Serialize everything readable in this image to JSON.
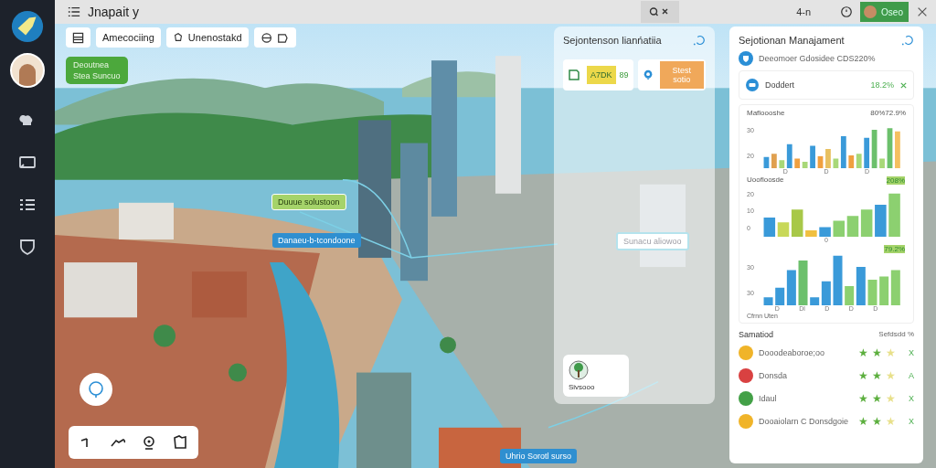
{
  "app": {
    "title": "Jnapait y"
  },
  "topbar": {
    "counter": "4-n",
    "user": "Oseo"
  },
  "toolbar": {
    "buttons": [
      {
        "kind": "icon"
      },
      {
        "kind": "text",
        "label": "Amecociing"
      },
      {
        "kind": "icon-text",
        "label": "Unenostakd"
      },
      {
        "kind": "icons"
      }
    ]
  },
  "map": {
    "badge": [
      "Deoutnea",
      "Stea Suncuo"
    ],
    "callouts": [
      {
        "text": "Duuue solustoon",
        "kind": "green"
      },
      {
        "text": "Danaeu-b-tcondoone",
        "kind": "blue"
      },
      {
        "text": "Sunacu aliowoo",
        "kind": "white"
      },
      {
        "text": "Uhrio Sorotl surso",
        "kind": "blue"
      }
    ]
  },
  "float_panel": {
    "title": "Sejontenson lianńatiia",
    "chip": "A7DK",
    "value": "89",
    "action": "Stest sotio",
    "card_label": "Sivsooo"
  },
  "side_panel": {
    "title": "Sejotionan Manajament",
    "info": "Deeomoer Gdosidee CDS220%",
    "card": {
      "label": "Doddert",
      "value": "18.2%"
    },
    "charts": [
      {
        "title": "Mafloooshe",
        "value": "80%72.9%",
        "ticks": [
          "30",
          "20"
        ],
        "axis": [
          "D",
          "D",
          "D"
        ]
      },
      {
        "title": "Uoofloosde",
        "value": "208%",
        "ticks": [
          "20",
          "10",
          "0"
        ],
        "axis": [
          "0"
        ]
      },
      {
        "value": "79.2%",
        "ticks": [
          "30",
          "30"
        ],
        "axis": [
          "D",
          "Dl",
          "D",
          "D",
          "D"
        ]
      }
    ],
    "footer": "Cfrnn Uten",
    "list_title": "Samatiod",
    "list_value": "Sefdsdd %",
    "items": [
      {
        "label": "Dooodeaboroe;oo",
        "color": "#f0b429",
        "stars": 2,
        "action": "X"
      },
      {
        "label": "Donsda",
        "color": "#d94141",
        "stars": 2,
        "action": "A"
      },
      {
        "label": "Idaul",
        "color": "#43a047",
        "stars": 2,
        "action": "X"
      },
      {
        "label": "Dooaiolarn C Donsdgoie",
        "color": "#f0b429",
        "stars": 2,
        "action": "X"
      }
    ]
  }
}
